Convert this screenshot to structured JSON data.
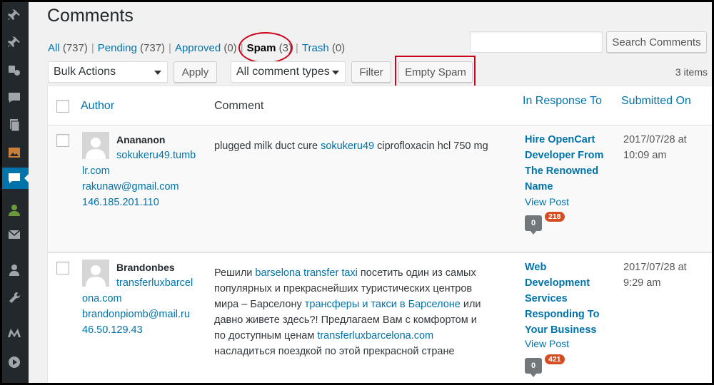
{
  "page": {
    "title": "Comments"
  },
  "filters": {
    "all_label": "All",
    "all_count": "(737)",
    "pending_label": "Pending",
    "pending_count": "(737)",
    "approved_label": "Approved",
    "approved_count": "(0)",
    "spam_label": "Spam",
    "spam_count": "(3)",
    "trash_label": "Trash",
    "trash_count": "(0)",
    "separator": "|"
  },
  "search": {
    "value": "",
    "button_label": "Search Comments"
  },
  "toolbar": {
    "bulk_actions": "Bulk Actions",
    "apply_label": "Apply",
    "comment_types": "All comment types",
    "filter_label": "Filter",
    "empty_spam_label": "Empty Spam",
    "items_count": "3 items"
  },
  "table": {
    "columns": {
      "author": "Author",
      "comment": "Comment",
      "in_response_to": "In Response To",
      "submitted_on": "Submitted On"
    },
    "rows": [
      {
        "author_name": "Anananon",
        "author_url_line1": "sokukeru49.tumb",
        "author_url_line2": "lr.com",
        "author_email": "rakunaw@gmail.com",
        "author_ip": "146.185.201.110",
        "comment_part1": "plugged milk duct cure ",
        "comment_link1": "sokukeru49",
        "comment_part2": " ciprofloxacin hcl 750 mg",
        "response_title": [
          "Hire OpenCart",
          "Developer From",
          "The Renowned",
          "Name"
        ],
        "view_post": "View Post",
        "approved_count": "0",
        "pending_count": "218",
        "date": "2017/07/28 at",
        "time": "10:09 am"
      },
      {
        "author_name": "Brandonbes",
        "author_url_line1": "transferluxbarcel",
        "author_url_line2": "ona.com",
        "author_email": "brandonpiomb@mail.ru",
        "author_ip": "46.50.129.43",
        "comment_part1": "Решили ",
        "comment_link1": "barselona transfer taxi",
        "comment_part2": " посетить один из самых популярных и прекраснейших туристических центров мира – Барселону ",
        "comment_link2": "трансферы и такси в Барселоне",
        "comment_part3": " или давно живете здесь?! Предлагаем Вам с комфортом и по доступным ценам ",
        "comment_link3": "transferluxbarcelona.com",
        "comment_part4": " насладиться поездкой по этой прекрасной стране",
        "response_title": [
          "Web",
          "Development",
          "Services",
          "Responding To",
          "Your Business"
        ],
        "view_post": "View Post",
        "approved_count": "0",
        "pending_count": "421",
        "date": "2017/07/28 at",
        "time": "9:29 am"
      }
    ]
  },
  "sidebar": {
    "icons": [
      "pin-icon",
      "pin-icon",
      "media-icon",
      "comments-icon",
      "pages-icon",
      "image-icon",
      "comments-active-icon",
      "user-group-icon",
      "mail-icon",
      "users-icon",
      "tools-icon",
      "m-logo-icon",
      "play-icon"
    ]
  },
  "colors": {
    "link": "#0073aa",
    "sidebar": "#23282d",
    "active": "#0073aa",
    "highlight": "#d0021b",
    "badge": "#d54e21"
  }
}
